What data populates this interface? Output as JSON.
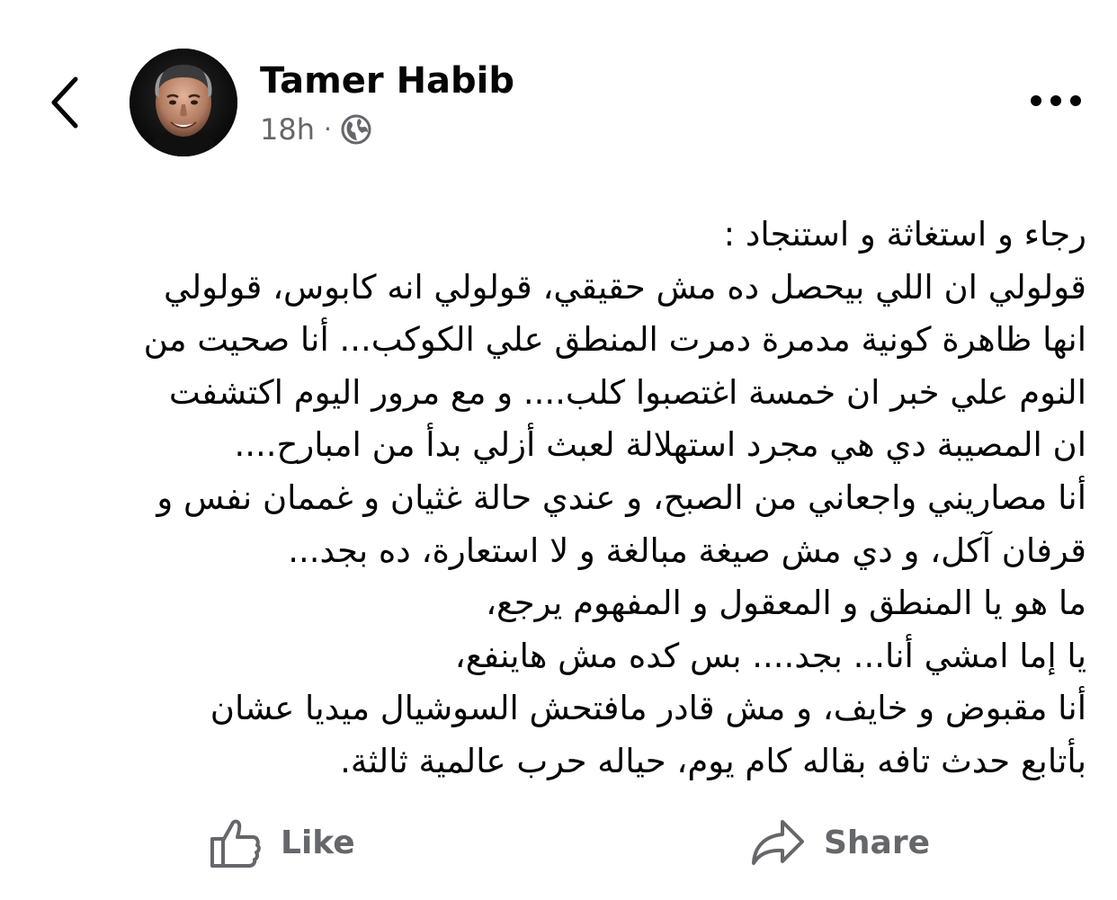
{
  "header": {
    "back_icon": "chevron-left-icon",
    "author_name": "Tamer Habib",
    "timestamp": "18h",
    "separator": "·",
    "audience_icon": "globe-icon",
    "more_icon": "more-horizontal-icon"
  },
  "post": {
    "lines": [
      "رجاء و استغاثة و استنجاد :",
      "قولولي ان اللي بيحصل ده مش حقيقي، قولولي انه كابوس، قولولي",
      "انها ظاهرة كونية مدمرة دمرت المنطق علي الكوكب... أنا صحيت من",
      "النوم علي خبر ان خمسة اغتصبوا كلب.... و مع مرور اليوم اكتشفت",
      "ان المصيبة دي هي مجرد استهلالة لعبث أزلي بدأ من امبارح....",
      "أنا مصاريني واجعاني من الصبح، و عندي حالة غثيان و غممان نفس و",
      "قرفان آكل، و دي مش صيغة مبالغة و لا استعارة، ده بجد...",
      "ما هو يا المنطق و المعقول و المفهوم يرجع،",
      "يا إما امشي أنا... بجد.... بس كده مش هاينفع،",
      "أنا مقبوض و خايف، و مش قادر مافتحش السوشيال ميديا عشان",
      "بأتابع حدث تافه بقاله كام يوم، حياله حرب عالمية ثالثة."
    ]
  },
  "actions": {
    "like_label": "Like",
    "like_icon": "thumbs-up-icon",
    "share_label": "Share",
    "share_icon": "share-arrow-icon"
  },
  "colors": {
    "text_primary": "#050505",
    "text_secondary": "#65676b",
    "background": "#ffffff"
  }
}
